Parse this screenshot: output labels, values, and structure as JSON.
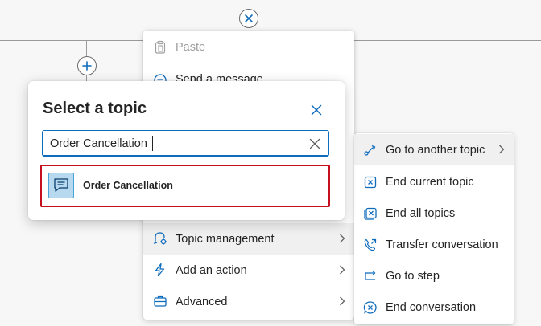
{
  "context_menu": {
    "items": [
      {
        "label": "Paste",
        "icon": "paste-icon"
      },
      {
        "label": "Send a message",
        "icon": "message-icon"
      },
      {
        "label": "Topic management",
        "icon": "topic-management-icon"
      },
      {
        "label": "Add an action",
        "icon": "action-icon"
      },
      {
        "label": "Advanced",
        "icon": "advanced-icon"
      }
    ]
  },
  "topic_submenu": {
    "items": [
      {
        "label": "Go to another topic",
        "icon": "redirect-icon"
      },
      {
        "label": "End current topic",
        "icon": "end-current-topic-icon"
      },
      {
        "label": "End all topics",
        "icon": "end-all-topics-icon"
      },
      {
        "label": "Transfer conversation",
        "icon": "transfer-icon"
      },
      {
        "label": "Go to step",
        "icon": "go-to-step-icon"
      },
      {
        "label": "End conversation",
        "icon": "end-conversation-icon"
      }
    ]
  },
  "dialog": {
    "title": "Select a topic",
    "search_value": "Order Cancellation",
    "results": [
      {
        "label": "Order Cancellation",
        "icon": "topic-chat-icon"
      }
    ]
  },
  "colors": {
    "accent": "#0f6cbd",
    "highlight_border": "#c50f1f",
    "hover": "#f0f0f0"
  }
}
